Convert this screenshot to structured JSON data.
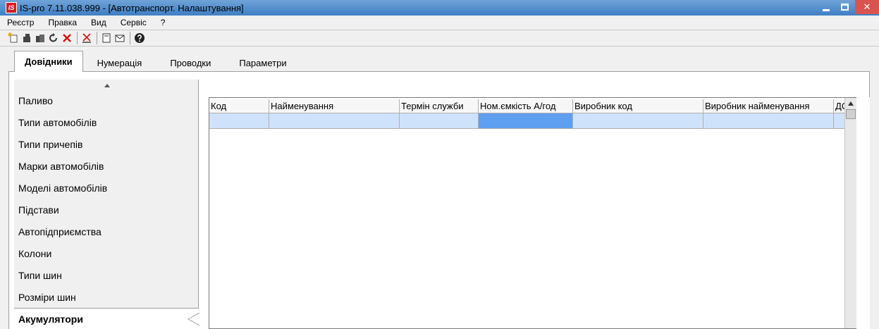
{
  "window": {
    "title": "IS-pro 7.11.038.999 - [Автотранспорт. Налаштування]",
    "logo_text": "IS",
    "close_glyph": "✕"
  },
  "menu": [
    "Реєстр",
    "Правка",
    "Вид",
    "Сервіс",
    "?"
  ],
  "toolbar": {
    "icons": [
      "new-icon",
      "copy-icon",
      "paste-icon",
      "refresh-icon",
      "delete-icon",
      "filter-clear-icon",
      "document-icon",
      "mail-icon",
      "help-icon"
    ]
  },
  "tabs": [
    {
      "label": "Довідники",
      "active": true
    },
    {
      "label": "Нумерація",
      "active": false
    },
    {
      "label": "Проводки",
      "active": false
    },
    {
      "label": "Параметри",
      "active": false
    }
  ],
  "sidebar": {
    "items": [
      {
        "label": "Паливо"
      },
      {
        "label": "Типи автомобілів"
      },
      {
        "label": "Типи причепів"
      },
      {
        "label": "Марки автомобілів"
      },
      {
        "label": "Моделі автомобілів"
      },
      {
        "label": "Підстави"
      },
      {
        "label": "Автопідприємства"
      },
      {
        "label": "Колони"
      },
      {
        "label": "Типи шин"
      },
      {
        "label": "Розміри шин"
      },
      {
        "label": "Акумулятори",
        "active": true
      }
    ]
  },
  "grid": {
    "columns": [
      {
        "label": "Код"
      },
      {
        "label": "Найменування"
      },
      {
        "label": "Термін служби"
      },
      {
        "label": "Ном.ємкість А/год"
      },
      {
        "label": "Виробник код"
      },
      {
        "label": "Виробник найменування"
      },
      {
        "label": "ДС"
      }
    ],
    "rows": [
      [
        "",
        "",
        "",
        "",
        "",
        "",
        ""
      ]
    ],
    "focused_column": 3
  },
  "colors": {
    "titlebar": "#3f7fc4",
    "selected_row": "#cfe2fb",
    "focused_cell": "#5f9ff0",
    "close_button": "#d9534f"
  }
}
